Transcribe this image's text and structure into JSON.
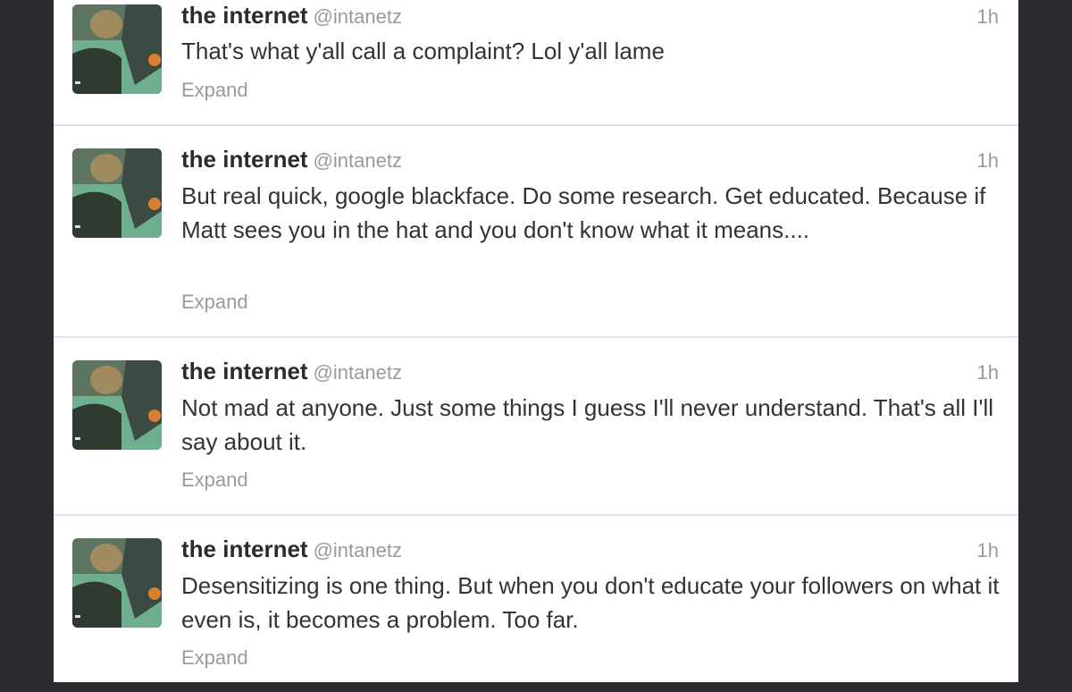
{
  "tweets": [
    {
      "name": "the internet",
      "handle": "@intanetz",
      "time": "1h",
      "text": "That's what y'all call a complaint? Lol y'all lame",
      "expand": "Expand"
    },
    {
      "name": "the internet",
      "handle": "@intanetz",
      "time": "1h",
      "text": "But real quick, google blackface. Do some research. Get educated. Because if Matt sees you in the hat and you don't know what it means....",
      "expand": "Expand"
    },
    {
      "name": "the internet",
      "handle": "@intanetz",
      "time": "1h",
      "text": "Not mad at anyone. Just some things I guess I'll never understand. That's all I'll say about it.",
      "expand": "Expand"
    },
    {
      "name": "the internet",
      "handle": "@intanetz",
      "time": "1h",
      "text": "Desensitizing is one thing. But when you don't educate your followers on what it even is, it becomes a problem. Too far.",
      "expand": "Expand"
    }
  ]
}
